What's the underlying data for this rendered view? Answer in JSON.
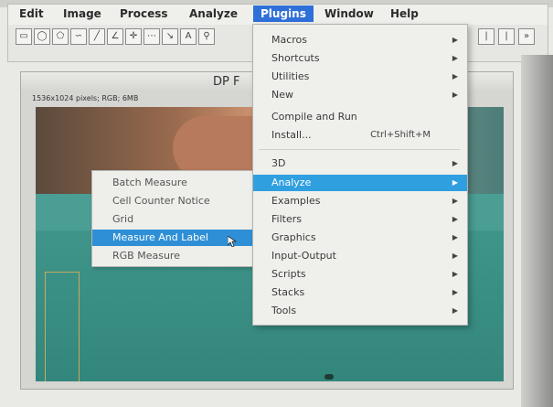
{
  "menubar": {
    "items": [
      {
        "label": "Edit"
      },
      {
        "label": "Image"
      },
      {
        "label": "Process"
      },
      {
        "label": "Analyze"
      },
      {
        "label": "Plugins",
        "active": true
      },
      {
        "label": "Window"
      },
      {
        "label": "Help"
      }
    ]
  },
  "toolbar": {
    "tools": [
      "rectangle-tool-icon",
      "oval-tool-icon",
      "polygon-tool-icon",
      "line-tool-icon",
      "angle-tool-icon",
      "point-tool-icon",
      "wand-tool-icon",
      "text-tool-icon",
      "zoom-tool-icon"
    ]
  },
  "image_window": {
    "title": "DP F",
    "info": "1536x1024 pixels; RGB; 6MB"
  },
  "plugins_menu": {
    "items": [
      {
        "label": "Macros",
        "submenu": true
      },
      {
        "label": "Shortcuts",
        "submenu": true
      },
      {
        "label": "Utilities",
        "submenu": true
      },
      {
        "label": "New",
        "submenu": true
      },
      {
        "label": "Compile and Run",
        "submenu": false
      },
      {
        "label": "Install...",
        "submenu": false,
        "shortcut": "Ctrl+Shift+M"
      },
      {
        "label": "3D",
        "submenu": true
      },
      {
        "label": "Analyze",
        "submenu": true,
        "highlighted": true
      },
      {
        "label": "Examples",
        "submenu": true
      },
      {
        "label": "Filters",
        "submenu": true
      },
      {
        "label": "Graphics",
        "submenu": true
      },
      {
        "label": "Input-Output",
        "submenu": true
      },
      {
        "label": "Scripts",
        "submenu": true
      },
      {
        "label": "Stacks",
        "submenu": true
      },
      {
        "label": "Tools",
        "submenu": true
      }
    ]
  },
  "analyze_submenu": {
    "items": [
      {
        "label": "Batch Measure"
      },
      {
        "label": "Cell Counter Notice"
      },
      {
        "label": "Grid"
      },
      {
        "label": "Measure And Label",
        "highlighted": true
      },
      {
        "label": "RGB Measure"
      }
    ]
  },
  "colors": {
    "highlight": "#2f9fe0",
    "menu_bg": "#efefec"
  }
}
